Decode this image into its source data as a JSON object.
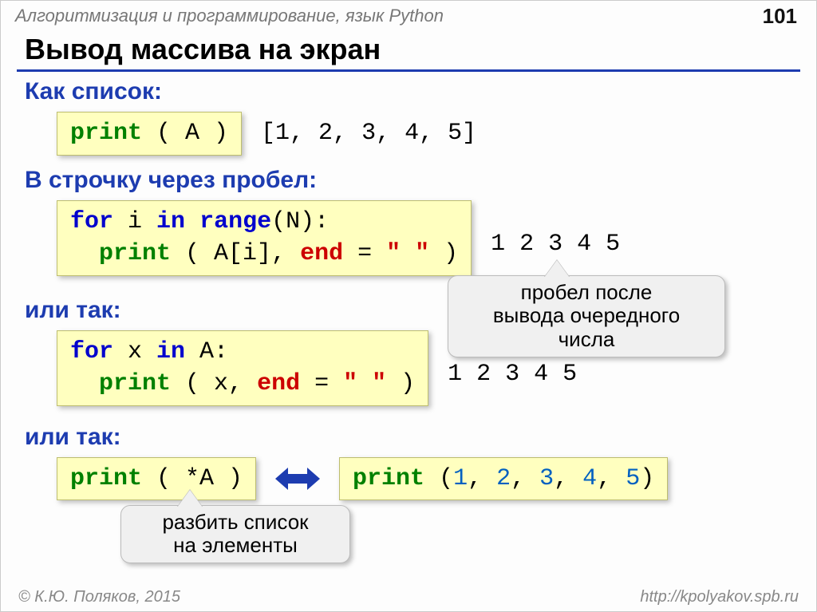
{
  "header": {
    "course": "Алгоритмизация и программирование, язык Python",
    "page": "101"
  },
  "title": "Вывод массива на экран",
  "s1": {
    "heading": "Как список:",
    "code_print": "print",
    "code_rest": " ( A )",
    "output": "[1, 2, 3, 4, 5]"
  },
  "s2": {
    "heading": "В строчку через пробел:",
    "for": "for",
    "in": "in",
    "range": "range",
    "line1_rest": "(N):",
    "print": "print",
    "line2_a": " ( A[i], ",
    "end": "end",
    "eq": " = ",
    "quote": "\" \"",
    "close": " )",
    "output": "1 2 3 4 5",
    "note": "пробел после\nвывода очередного\nчисла"
  },
  "s3": {
    "heading": "или так:",
    "for": "for",
    "in": "in",
    "line1_rest": " A:",
    "print": "print",
    "line2_a": " ( x, ",
    "end": "end",
    "eq": " = ",
    "quote": "\" \"",
    "close": " )",
    "output": "1 2 3 4 5"
  },
  "s4": {
    "heading": "или так:",
    "print1": "print",
    "rest1": " ( *A )",
    "print2": "print",
    "open2": " (",
    "n1": "1",
    "n2": "2",
    "n3": "3",
    "n4": "4",
    "n5": "5",
    "comma": ", ",
    "close2": ")",
    "note": "разбить список\nна элементы"
  },
  "footer": {
    "left": "© К.Ю. Поляков, 2015",
    "right": "http://kpolyakov.spb.ru"
  }
}
